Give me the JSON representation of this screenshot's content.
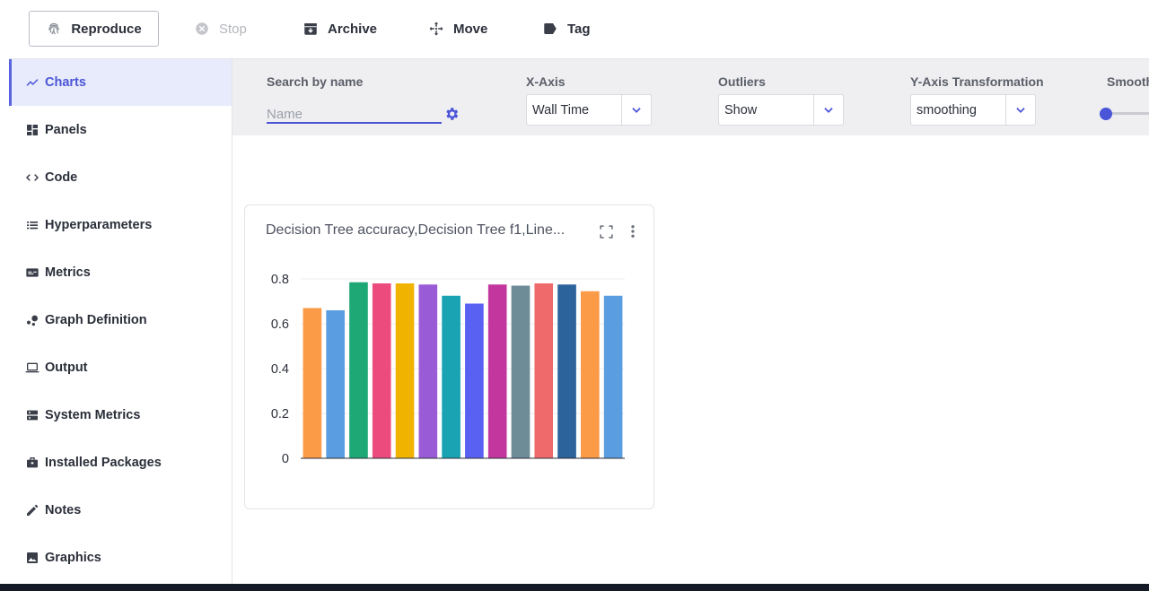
{
  "toolbar": {
    "reproduce": "Reproduce",
    "stop": "Stop",
    "archive": "Archive",
    "move": "Move",
    "tag": "Tag"
  },
  "sidebar": {
    "items": [
      {
        "label": "Charts",
        "icon": "chart-line-icon"
      },
      {
        "label": "Panels",
        "icon": "panels-icon"
      },
      {
        "label": "Code",
        "icon": "code-icon"
      },
      {
        "label": "Hyperparameters",
        "icon": "list-icon"
      },
      {
        "label": "Metrics",
        "icon": "metrics-icon"
      },
      {
        "label": "Graph Definition",
        "icon": "graph-icon"
      },
      {
        "label": "Output",
        "icon": "laptop-icon"
      },
      {
        "label": "System Metrics",
        "icon": "server-icon"
      },
      {
        "label": "Installed Packages",
        "icon": "package-icon"
      },
      {
        "label": "Notes",
        "icon": "pencil-icon"
      },
      {
        "label": "Graphics",
        "icon": "image-icon"
      }
    ],
    "active": "Charts"
  },
  "filters": {
    "search_label": "Search by name",
    "search_placeholder": "Name",
    "search_value": "",
    "xaxis_label": "X-Axis",
    "xaxis_value": "Wall Time",
    "outliers_label": "Outliers",
    "outliers_value": "Show",
    "yaxis_label": "Y-Axis Transformation",
    "yaxis_value": "smoothing",
    "smoothing_label": "Smooth"
  },
  "colors": {
    "accent": "#4a55d8",
    "active_bg": "#e8ebfb",
    "filter_bg": "#efeff1"
  },
  "chart_card": {
    "title": "Decision Tree accuracy,Decision Tree f1,Line..."
  },
  "chart_data": {
    "type": "bar",
    "values": [
      0.67,
      0.66,
      0.785,
      0.78,
      0.78,
      0.775,
      0.725,
      0.69,
      0.775,
      0.77,
      0.78,
      0.775,
      0.745,
      0.725
    ],
    "colors": [
      "#fb9a47",
      "#5a9de0",
      "#1ea876",
      "#ec4b7e",
      "#f0b400",
      "#9a5cd6",
      "#1aa3b3",
      "#5961f2",
      "#c2369e",
      "#6e8b98",
      "#ef6b6b",
      "#2c639b",
      "#fb9a47",
      "#5a9de0"
    ],
    "yticks": [
      "0",
      "0.2",
      "0.4",
      "0.6",
      "0.8"
    ],
    "ylim": [
      0,
      0.8
    ],
    "grid": true
  }
}
